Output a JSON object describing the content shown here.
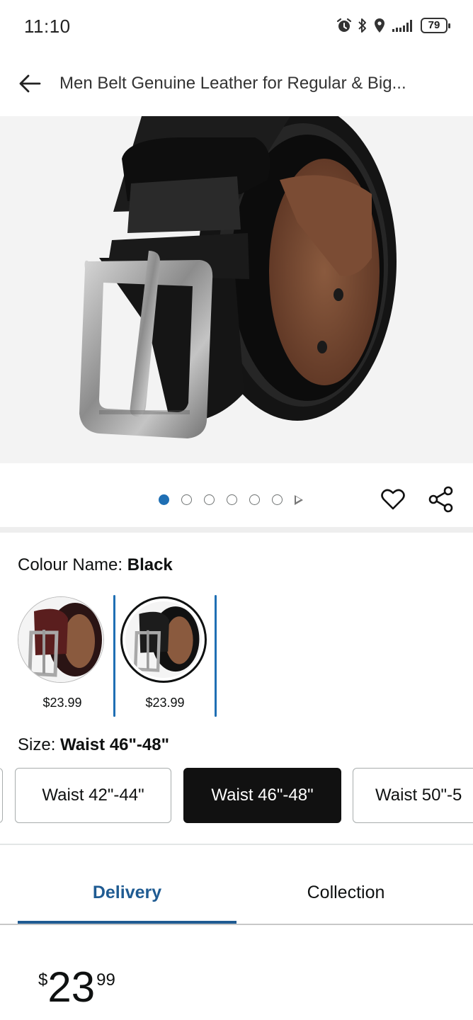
{
  "status_bar": {
    "time": "11:10",
    "battery": "79"
  },
  "header": {
    "title": "Men Belt Genuine Leather for Regular & Big..."
  },
  "carousel": {
    "total_images": 6,
    "active_index": 0,
    "has_video": true
  },
  "colour": {
    "label": "Colour Name: ",
    "selected": "Black",
    "swatches": [
      {
        "name": "Brown",
        "price": "$23.99",
        "selected": false
      },
      {
        "name": "Black",
        "price": "$23.99",
        "selected": true
      }
    ]
  },
  "size": {
    "label": "Size: ",
    "selected": "Waist 46\"-48\"",
    "options": [
      {
        "label": "Waist 42\"-44\"",
        "selected": false
      },
      {
        "label": "Waist 46\"-48\"",
        "selected": true
      },
      {
        "label": "Waist 50\"-5",
        "selected": false
      }
    ]
  },
  "tabs": {
    "delivery": "Delivery",
    "collection": "Collection",
    "active": "Delivery"
  },
  "price": {
    "symbol": "$",
    "whole": "23",
    "fraction": "99"
  },
  "colors": {
    "accent": "#1f6fb4",
    "tab_active": "#1f5b92",
    "selected_size_bg": "#111111"
  }
}
